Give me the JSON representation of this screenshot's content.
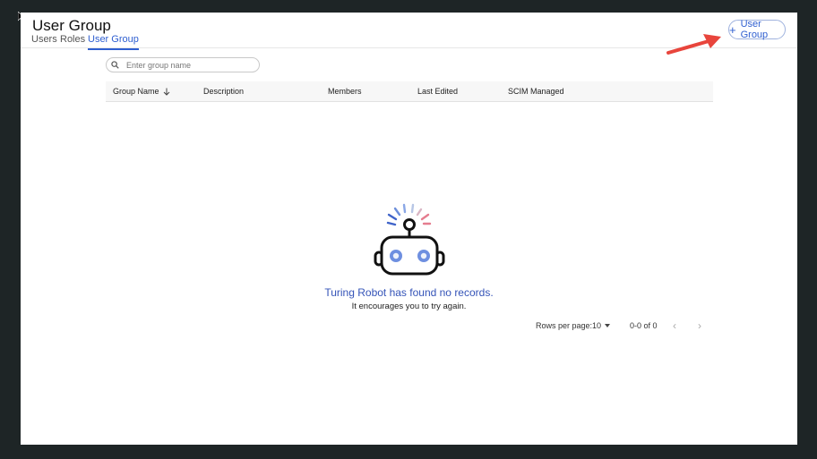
{
  "header": {
    "title": "User Group",
    "add_button_label": "User Group"
  },
  "tabs": [
    {
      "label": "Users",
      "active": false
    },
    {
      "label": "Roles",
      "active": false
    },
    {
      "label": "User Group",
      "active": true
    }
  ],
  "search": {
    "placeholder": "Enter group name",
    "value": ""
  },
  "table": {
    "columns": [
      "Group Name",
      "Description",
      "Members",
      "Last Edited",
      "SCIM Managed"
    ],
    "sort_column": "Group Name",
    "sort_direction": "descending",
    "rows": []
  },
  "empty_state": {
    "title": "Turing Robot has found no records.",
    "subtitle": "It encourages you to try again."
  },
  "pagination": {
    "rows_per_page_label": "Rows per page:",
    "rows_per_page_value": "10",
    "range_text": "0-0 of 0"
  },
  "colors": {
    "accent": "#2f5fd0",
    "empty_title": "#3554b8",
    "annotation_arrow": "#e8453c",
    "background": "#1e2526"
  },
  "icons": {
    "search": "search-icon",
    "add": "plus-icon",
    "sort": "arrow-down-icon",
    "rows_dropdown": "caret-down-icon",
    "prev_page": "chevron-left-icon",
    "next_page": "chevron-right-icon",
    "empty_state": "robot-icon",
    "annotation": "red-arrow-icon"
  }
}
